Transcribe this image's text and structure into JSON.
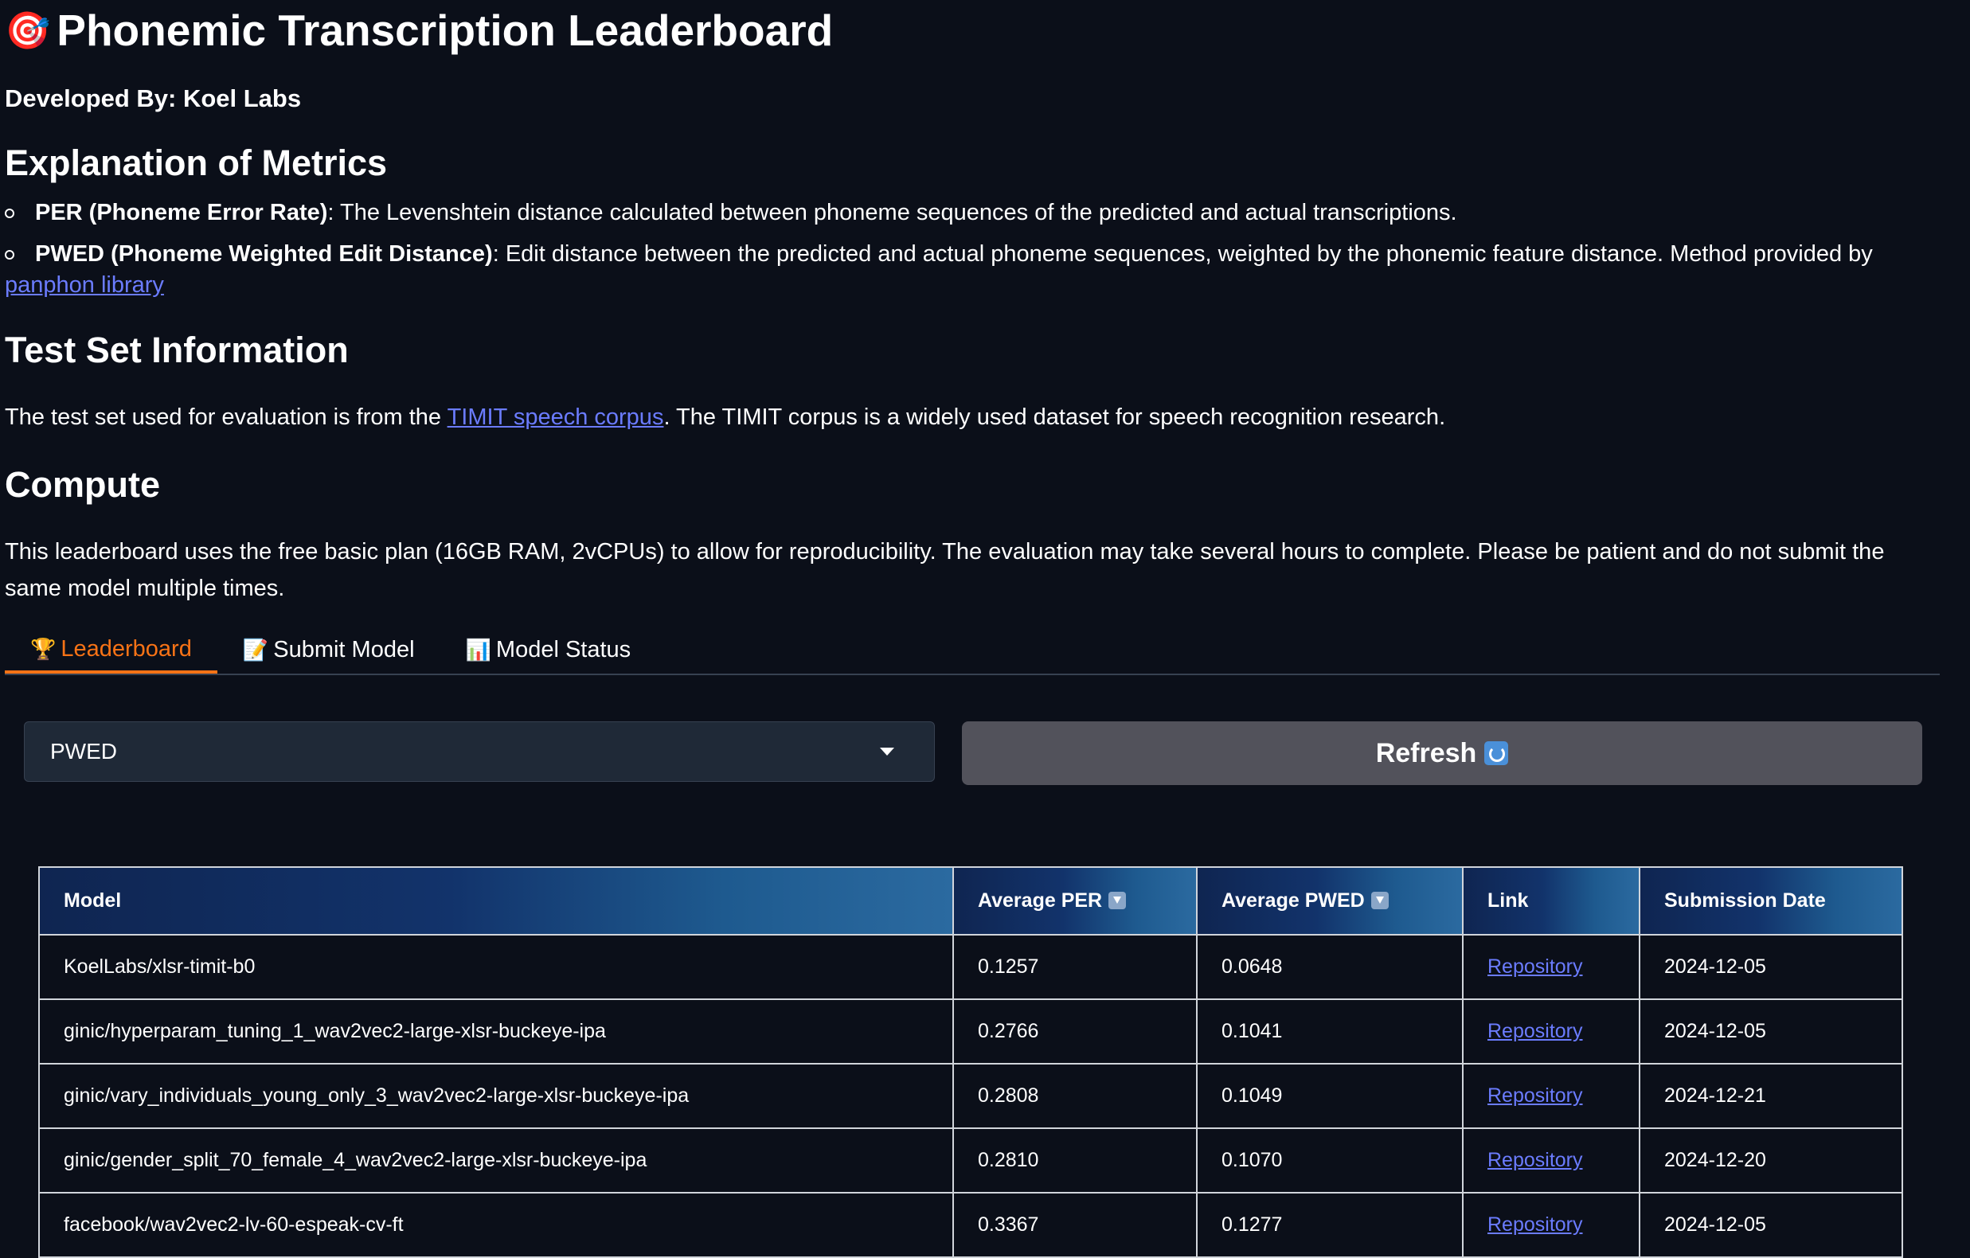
{
  "header": {
    "title_icon": "🎯",
    "title": "Phonemic Transcription Leaderboard",
    "developer": "Developed By: Koel Labs"
  },
  "metrics": {
    "heading": "Explanation of Metrics",
    "items": [
      {
        "name": "PER (Phoneme Error Rate)",
        "description": ": The Levenshtein distance calculated between phoneme sequences of the predicted and actual transcriptions."
      },
      {
        "name": "PWED (Phoneme Weighted Edit Distance)",
        "description": ": Edit distance between the predicted and actual phoneme sequences, weighted by the phonemic feature distance. Method provided by",
        "link_text": "panphon library"
      }
    ]
  },
  "test_set": {
    "heading": "Test Set Information",
    "text_before": "The test set used for evaluation is from the ",
    "link_text": "TIMIT speech corpus",
    "text_after": ". The TIMIT corpus is a widely used dataset for speech recognition research."
  },
  "compute": {
    "heading": "Compute",
    "text": "This leaderboard uses the free basic plan (16GB RAM, 2vCPUs) to allow for reproducibility. The evaluation may take several hours to complete. Please be patient and do not submit the same model multiple times."
  },
  "tabs": [
    {
      "icon": "🏆",
      "label": "Leaderboard",
      "active": true
    },
    {
      "icon": "📝",
      "label": "Submit Model",
      "active": false
    },
    {
      "icon": "📊",
      "label": "Model Status",
      "active": false
    }
  ],
  "controls": {
    "dropdown_value": "PWED",
    "refresh_label": "Refresh"
  },
  "table": {
    "headers": [
      "Model",
      "Average PER",
      "Average PWED",
      "Link",
      "Submission Date"
    ],
    "rows": [
      [
        "KoelLabs/xlsr-timit-b0",
        "0.1257",
        "0.0648",
        "Repository",
        "2024-12-05"
      ],
      [
        "ginic/hyperparam_tuning_1_wav2vec2-large-xlsr-buckeye-ipa",
        "0.2766",
        "0.1041",
        "Repository",
        "2024-12-05"
      ],
      [
        "ginic/vary_individuals_young_only_3_wav2vec2-large-xlsr-buckeye-ipa",
        "0.2808",
        "0.1049",
        "Repository",
        "2024-12-21"
      ],
      [
        "ginic/gender_split_70_female_4_wav2vec2-large-xlsr-buckeye-ipa",
        "0.2810",
        "0.1070",
        "Repository",
        "2024-12-20"
      ],
      [
        "facebook/wav2vec2-lv-60-espeak-cv-ft",
        "0.3367",
        "0.1277",
        "Repository",
        "2024-12-05"
      ]
    ]
  },
  "colors": {
    "background": "#0b0f19",
    "accent": "#f97316",
    "link": "#6b7cff",
    "button": "#52525b"
  }
}
